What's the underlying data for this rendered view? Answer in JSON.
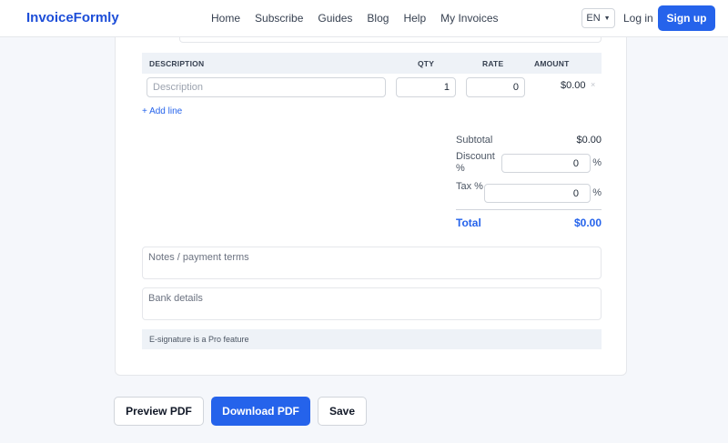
{
  "header": {
    "logo": "InvoiceFormly",
    "nav": [
      "Home",
      "Subscribe",
      "Guides",
      "Blog",
      "Help",
      "My Invoices"
    ],
    "language": "EN",
    "login": "Log in",
    "signup": "Sign up"
  },
  "table": {
    "headers": {
      "description": "DESCRIPTION",
      "qty": "QTY",
      "rate": "RATE",
      "amount": "AMOUNT"
    },
    "rows": [
      {
        "description_placeholder": "Description",
        "qty": "1",
        "rate": "0",
        "amount": "$0.00",
        "remove": "×"
      }
    ],
    "add_line": "+ Add line"
  },
  "totals": {
    "subtotal_label": "Subtotal",
    "subtotal_value": "$0.00",
    "discount_label": "Discount %",
    "discount_value": "0",
    "discount_unit": "%",
    "tax_label": "Tax %",
    "tax_value": "0",
    "tax_unit": "%",
    "total_label": "Total",
    "total_value": "$0.00"
  },
  "notes_placeholder": "Notes / payment terms",
  "bank_placeholder": "Bank details",
  "esignature_notice": "E-signature is a Pro feature",
  "actions": {
    "preview": "Preview PDF",
    "download": "Download PDF",
    "save": "Save"
  },
  "colors": {
    "accent": "#2563eb",
    "brand": "#1d4ed8",
    "background": "#f5f7fb"
  }
}
